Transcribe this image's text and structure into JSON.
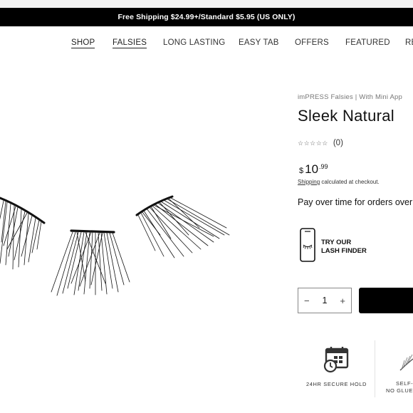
{
  "announcement": "Free Shipping $24.99+/Standard $5.95 (US ONLY)",
  "nav": {
    "items": [
      "SHOP",
      "FALSIES",
      "LONG LASTING",
      "EASY TAB",
      "OFFERS",
      "FEATURED",
      "RE"
    ]
  },
  "product": {
    "vendor": "imPRESS Falsies | With Mini App",
    "title": "Sleek Natural",
    "rating_count": "(0)",
    "stars": "☆☆☆☆☆",
    "price_currency": "$",
    "price_whole": "10",
    "price_cents": ".99",
    "shipping_link": "Shipping",
    "shipping_rest": " calculated at checkout.",
    "pay_over_time": "Pay over time for orders over"
  },
  "lash_finder": {
    "line1": "TRY OUR",
    "line2": "LASH FINDER"
  },
  "quantity": {
    "minus": "−",
    "value": "1",
    "plus": "+"
  },
  "badges": {
    "secure_hold": "24HR SECURE HOLD",
    "self_top": "SELF-",
    "self_bottom": "NO GLUE"
  },
  "colors": {
    "announcement_bg": "#000000",
    "add_to_cart_bg": "#000000"
  }
}
